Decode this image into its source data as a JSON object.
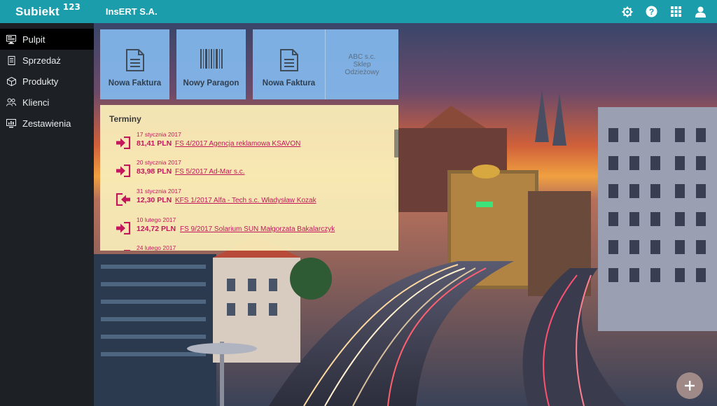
{
  "app": {
    "brand_name": "Subiekt",
    "brand_sup": "123",
    "company": "InsERT S.A."
  },
  "topbar_icons": [
    "gear-icon",
    "help-icon",
    "apps-grid-icon",
    "user-icon"
  ],
  "sidebar": {
    "items": [
      {
        "label": "Pulpit",
        "icon": "desktop-icon",
        "active": true
      },
      {
        "label": "Sprzedaż",
        "icon": "invoice-icon",
        "active": false
      },
      {
        "label": "Produkty",
        "icon": "box-icon",
        "active": false
      },
      {
        "label": "Klienci",
        "icon": "clients-icon",
        "active": false
      },
      {
        "label": "Zestawienia",
        "icon": "report-icon",
        "active": false
      }
    ]
  },
  "tiles": [
    {
      "label": "Nowa Faktura",
      "icon": "document-icon"
    },
    {
      "label": "Nowy Paragon",
      "icon": "barcode-icon"
    },
    {
      "label": "Nowa Faktura",
      "icon": "document-icon"
    }
  ],
  "shop": {
    "line1": "ABC s.c.",
    "line2": "Sklep",
    "line3": "Odzieżowy"
  },
  "terminy": {
    "title": "Terminy",
    "items": [
      {
        "date": "17 stycznia 2017",
        "amount": "81,41 PLN",
        "doc": "FS 4/2017 Agencja reklamowa KSAVON",
        "direction": "in"
      },
      {
        "date": "20 stycznia 2017",
        "amount": "83,98 PLN",
        "doc": "FS 5/2017 Ad-Mar s.c.",
        "direction": "in"
      },
      {
        "date": "31 stycznia 2017",
        "amount": "12,30 PLN",
        "doc": "KFS 1/2017 Alfa - Tech s.c.  Władysław Kozak",
        "direction": "out"
      },
      {
        "date": "10 lutego 2017",
        "amount": "124,72 PLN",
        "doc": "FS 9/2017 Solarium SUN  Małgorzata Bakalarczyk",
        "direction": "in"
      },
      {
        "date": "24 lutego 2017",
        "amount": "",
        "doc": "",
        "direction": "in"
      }
    ]
  },
  "fab": {
    "icon": "plus-icon"
  },
  "colors": {
    "topbar": "#1b9dab",
    "sidebar": "#1d2024",
    "accent": "#c2185b",
    "tile": "#82b8ee",
    "panel": "#f8ecb8"
  }
}
